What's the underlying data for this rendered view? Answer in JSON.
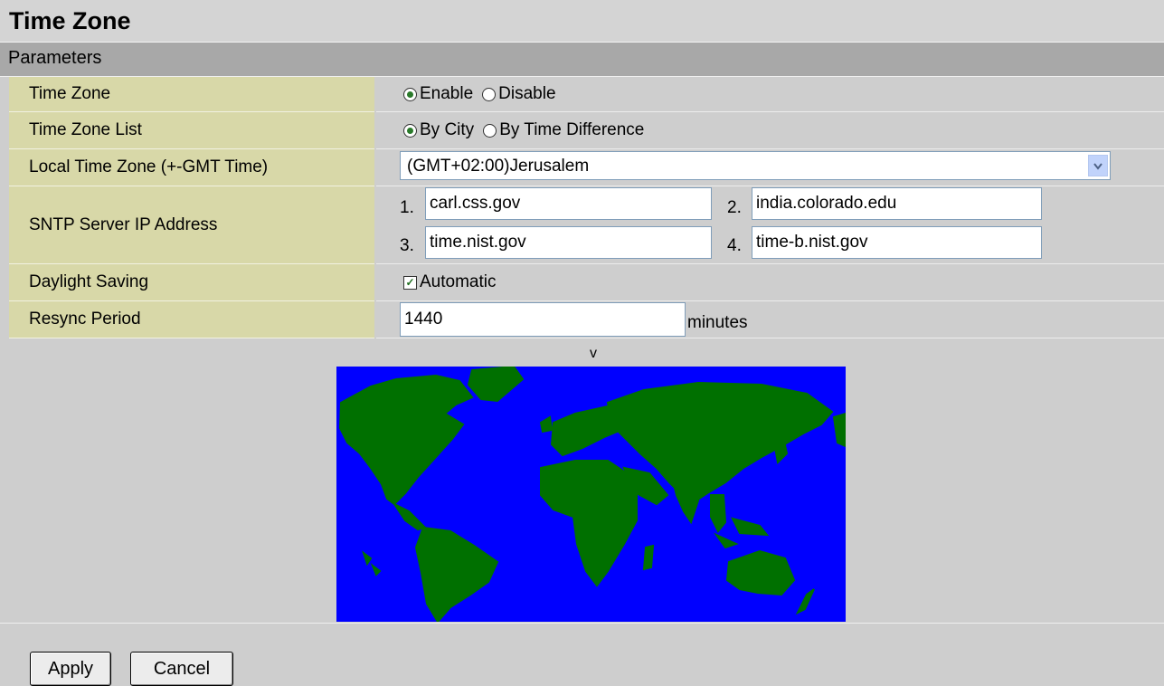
{
  "title": "Time Zone",
  "section": "Parameters",
  "rows": {
    "time_zone": {
      "label": "Time Zone",
      "options": [
        "Enable",
        "Disable"
      ],
      "selected": "Enable"
    },
    "time_zone_list": {
      "label": "Time Zone List",
      "options": [
        "By City",
        "By Time Difference"
      ],
      "selected": "By City"
    },
    "local_time_zone": {
      "label": "Local Time Zone (+-GMT Time)",
      "value": "(GMT+02:00)Jerusalem"
    },
    "sntp": {
      "label": "SNTP Server IP Address",
      "servers": [
        {
          "num": "1.",
          "value": "carl.css.gov"
        },
        {
          "num": "2.",
          "value": "india.colorado.edu"
        },
        {
          "num": "3.",
          "value": "time.nist.gov"
        },
        {
          "num": "4.",
          "value": "time-b.nist.gov"
        }
      ]
    },
    "daylight_saving": {
      "label": "Daylight Saving",
      "checkbox_label": "Automatic",
      "checked": true
    },
    "resync": {
      "label": "Resync Period",
      "value": "1440",
      "unit": "minutes"
    }
  },
  "map": {
    "marker": "v",
    "ocean_color": "#0000ff",
    "land_color": "#007000"
  },
  "buttons": {
    "apply": "Apply",
    "cancel": "Cancel"
  },
  "icons": {
    "dropdown": "chevron-down-icon",
    "check": "check-icon"
  }
}
